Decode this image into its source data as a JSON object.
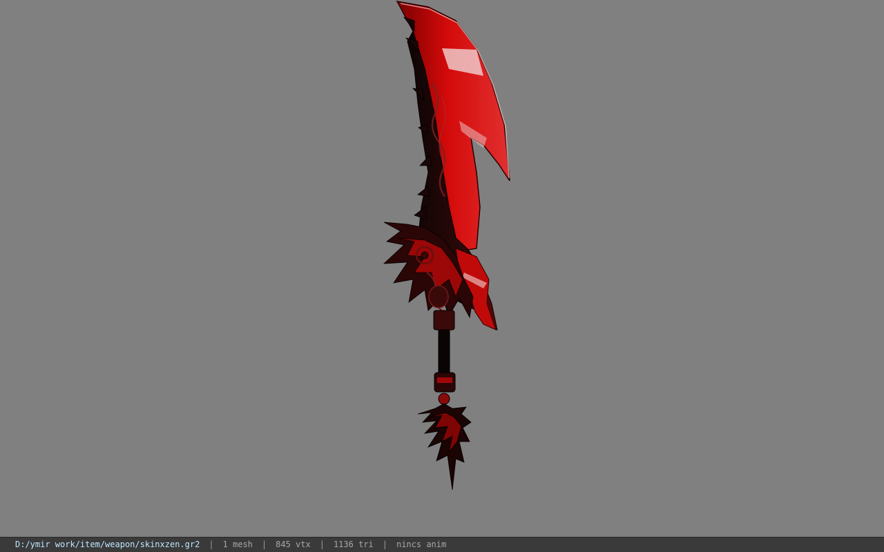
{
  "viewport": {
    "background_color": "#808080",
    "model": {
      "name": "red-black-curved-sword",
      "colors": {
        "blade_red": "#d40a0a",
        "blade_highlight": "#f0b0b0",
        "dark_metal": "#1a0a0a",
        "ornament": "#5a0a0a"
      }
    }
  },
  "statusbar": {
    "file_path": "D:/ymir work/item/weapon/skinxzen.gr2",
    "separator": "|",
    "mesh_count": "1 mesh",
    "vertex_count": "845 vtx",
    "triangle_count": "1136 tri",
    "anim_status": "nincs anim"
  }
}
